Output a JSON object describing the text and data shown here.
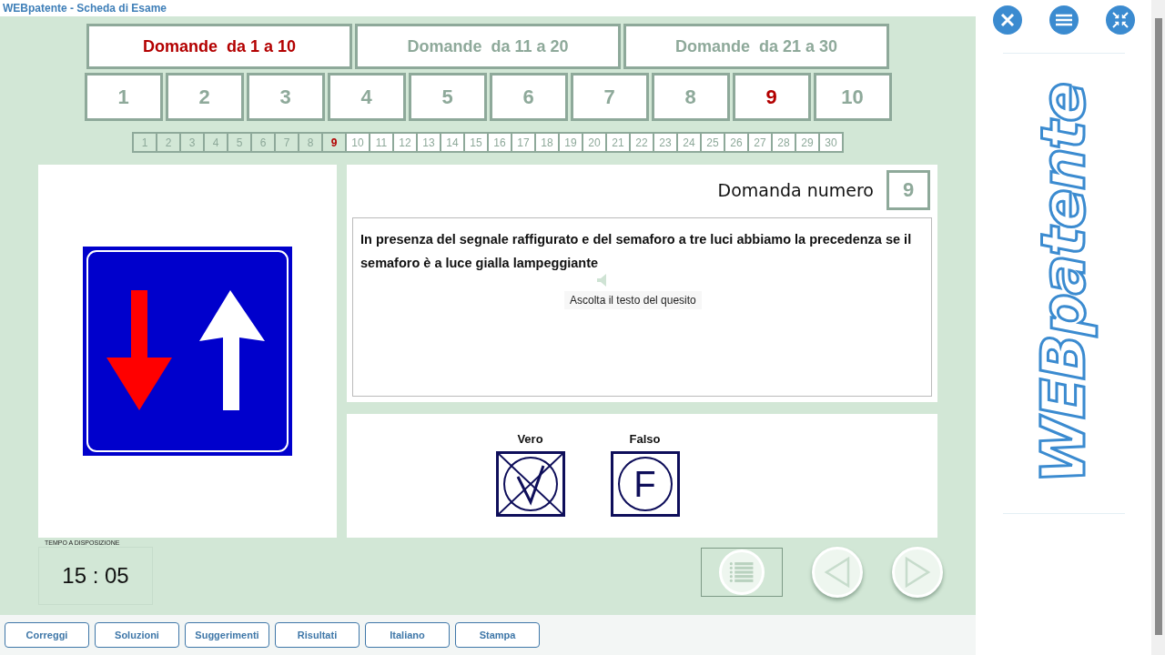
{
  "window": {
    "title": "WEBpatente - Scheda di Esame"
  },
  "range_tabs": [
    {
      "label": "Domande  da 1 a 10",
      "selected": true
    },
    {
      "label": "Domande  da 11 a 20",
      "selected": false
    },
    {
      "label": "Domande  da 21 a 30",
      "selected": false
    }
  ],
  "question_buttons": [
    {
      "label": "1",
      "selected": false
    },
    {
      "label": "2",
      "selected": false
    },
    {
      "label": "3",
      "selected": false
    },
    {
      "label": "4",
      "selected": false
    },
    {
      "label": "5",
      "selected": false
    },
    {
      "label": "6",
      "selected": false
    },
    {
      "label": "7",
      "selected": false
    },
    {
      "label": "8",
      "selected": false
    },
    {
      "label": "9",
      "selected": true
    },
    {
      "label": "10",
      "selected": false
    }
  ],
  "question_map": [
    {
      "label": "1",
      "visited": true,
      "selected": false
    },
    {
      "label": "2",
      "visited": true,
      "selected": false
    },
    {
      "label": "3",
      "visited": true,
      "selected": false
    },
    {
      "label": "4",
      "visited": true,
      "selected": false
    },
    {
      "label": "5",
      "visited": true,
      "selected": false
    },
    {
      "label": "6",
      "visited": true,
      "selected": false
    },
    {
      "label": "7",
      "visited": true,
      "selected": false
    },
    {
      "label": "8",
      "visited": true,
      "selected": false
    },
    {
      "label": "9",
      "visited": true,
      "selected": true
    },
    {
      "label": "10",
      "visited": false,
      "selected": false
    },
    {
      "label": "11",
      "visited": false,
      "selected": false
    },
    {
      "label": "12",
      "visited": false,
      "selected": false
    },
    {
      "label": "13",
      "visited": false,
      "selected": false
    },
    {
      "label": "14",
      "visited": false,
      "selected": false
    },
    {
      "label": "15",
      "visited": false,
      "selected": false
    },
    {
      "label": "16",
      "visited": false,
      "selected": false
    },
    {
      "label": "17",
      "visited": false,
      "selected": false
    },
    {
      "label": "18",
      "visited": false,
      "selected": false
    },
    {
      "label": "19",
      "visited": false,
      "selected": false
    },
    {
      "label": "20",
      "visited": false,
      "selected": false
    },
    {
      "label": "21",
      "visited": false,
      "selected": false
    },
    {
      "label": "22",
      "visited": false,
      "selected": false
    },
    {
      "label": "23",
      "visited": false,
      "selected": false
    },
    {
      "label": "24",
      "visited": false,
      "selected": false
    },
    {
      "label": "25",
      "visited": false,
      "selected": false
    },
    {
      "label": "26",
      "visited": false,
      "selected": false
    },
    {
      "label": "27",
      "visited": false,
      "selected": false
    },
    {
      "label": "28",
      "visited": false,
      "selected": false
    },
    {
      "label": "29",
      "visited": false,
      "selected": false
    },
    {
      "label": "30",
      "visited": false,
      "selected": false
    }
  ],
  "question": {
    "heading": "Domanda numero",
    "number": "9",
    "text": "In presenza del segnale raffigurato e del semaforo a tre luci abbiamo la precedenza se il semaforo è a luce gialla lampeggiante",
    "tooltip": "Ascolta il testo del quesito"
  },
  "answers": [
    {
      "label": "Vero",
      "kind": "check",
      "checked": true
    },
    {
      "label": "Falso",
      "kind": "letter",
      "letter": "F",
      "checked": false
    }
  ],
  "timer": {
    "label": "TEMPO A DISPOSIZIONE",
    "value": "15 : 05"
  },
  "bottom_buttons": [
    "Correggi",
    "Soluzioni",
    "Suggerimenti",
    "Risultati",
    "Italiano",
    "Stampa"
  ],
  "sidebar": {
    "logo": "WEBpatente"
  }
}
